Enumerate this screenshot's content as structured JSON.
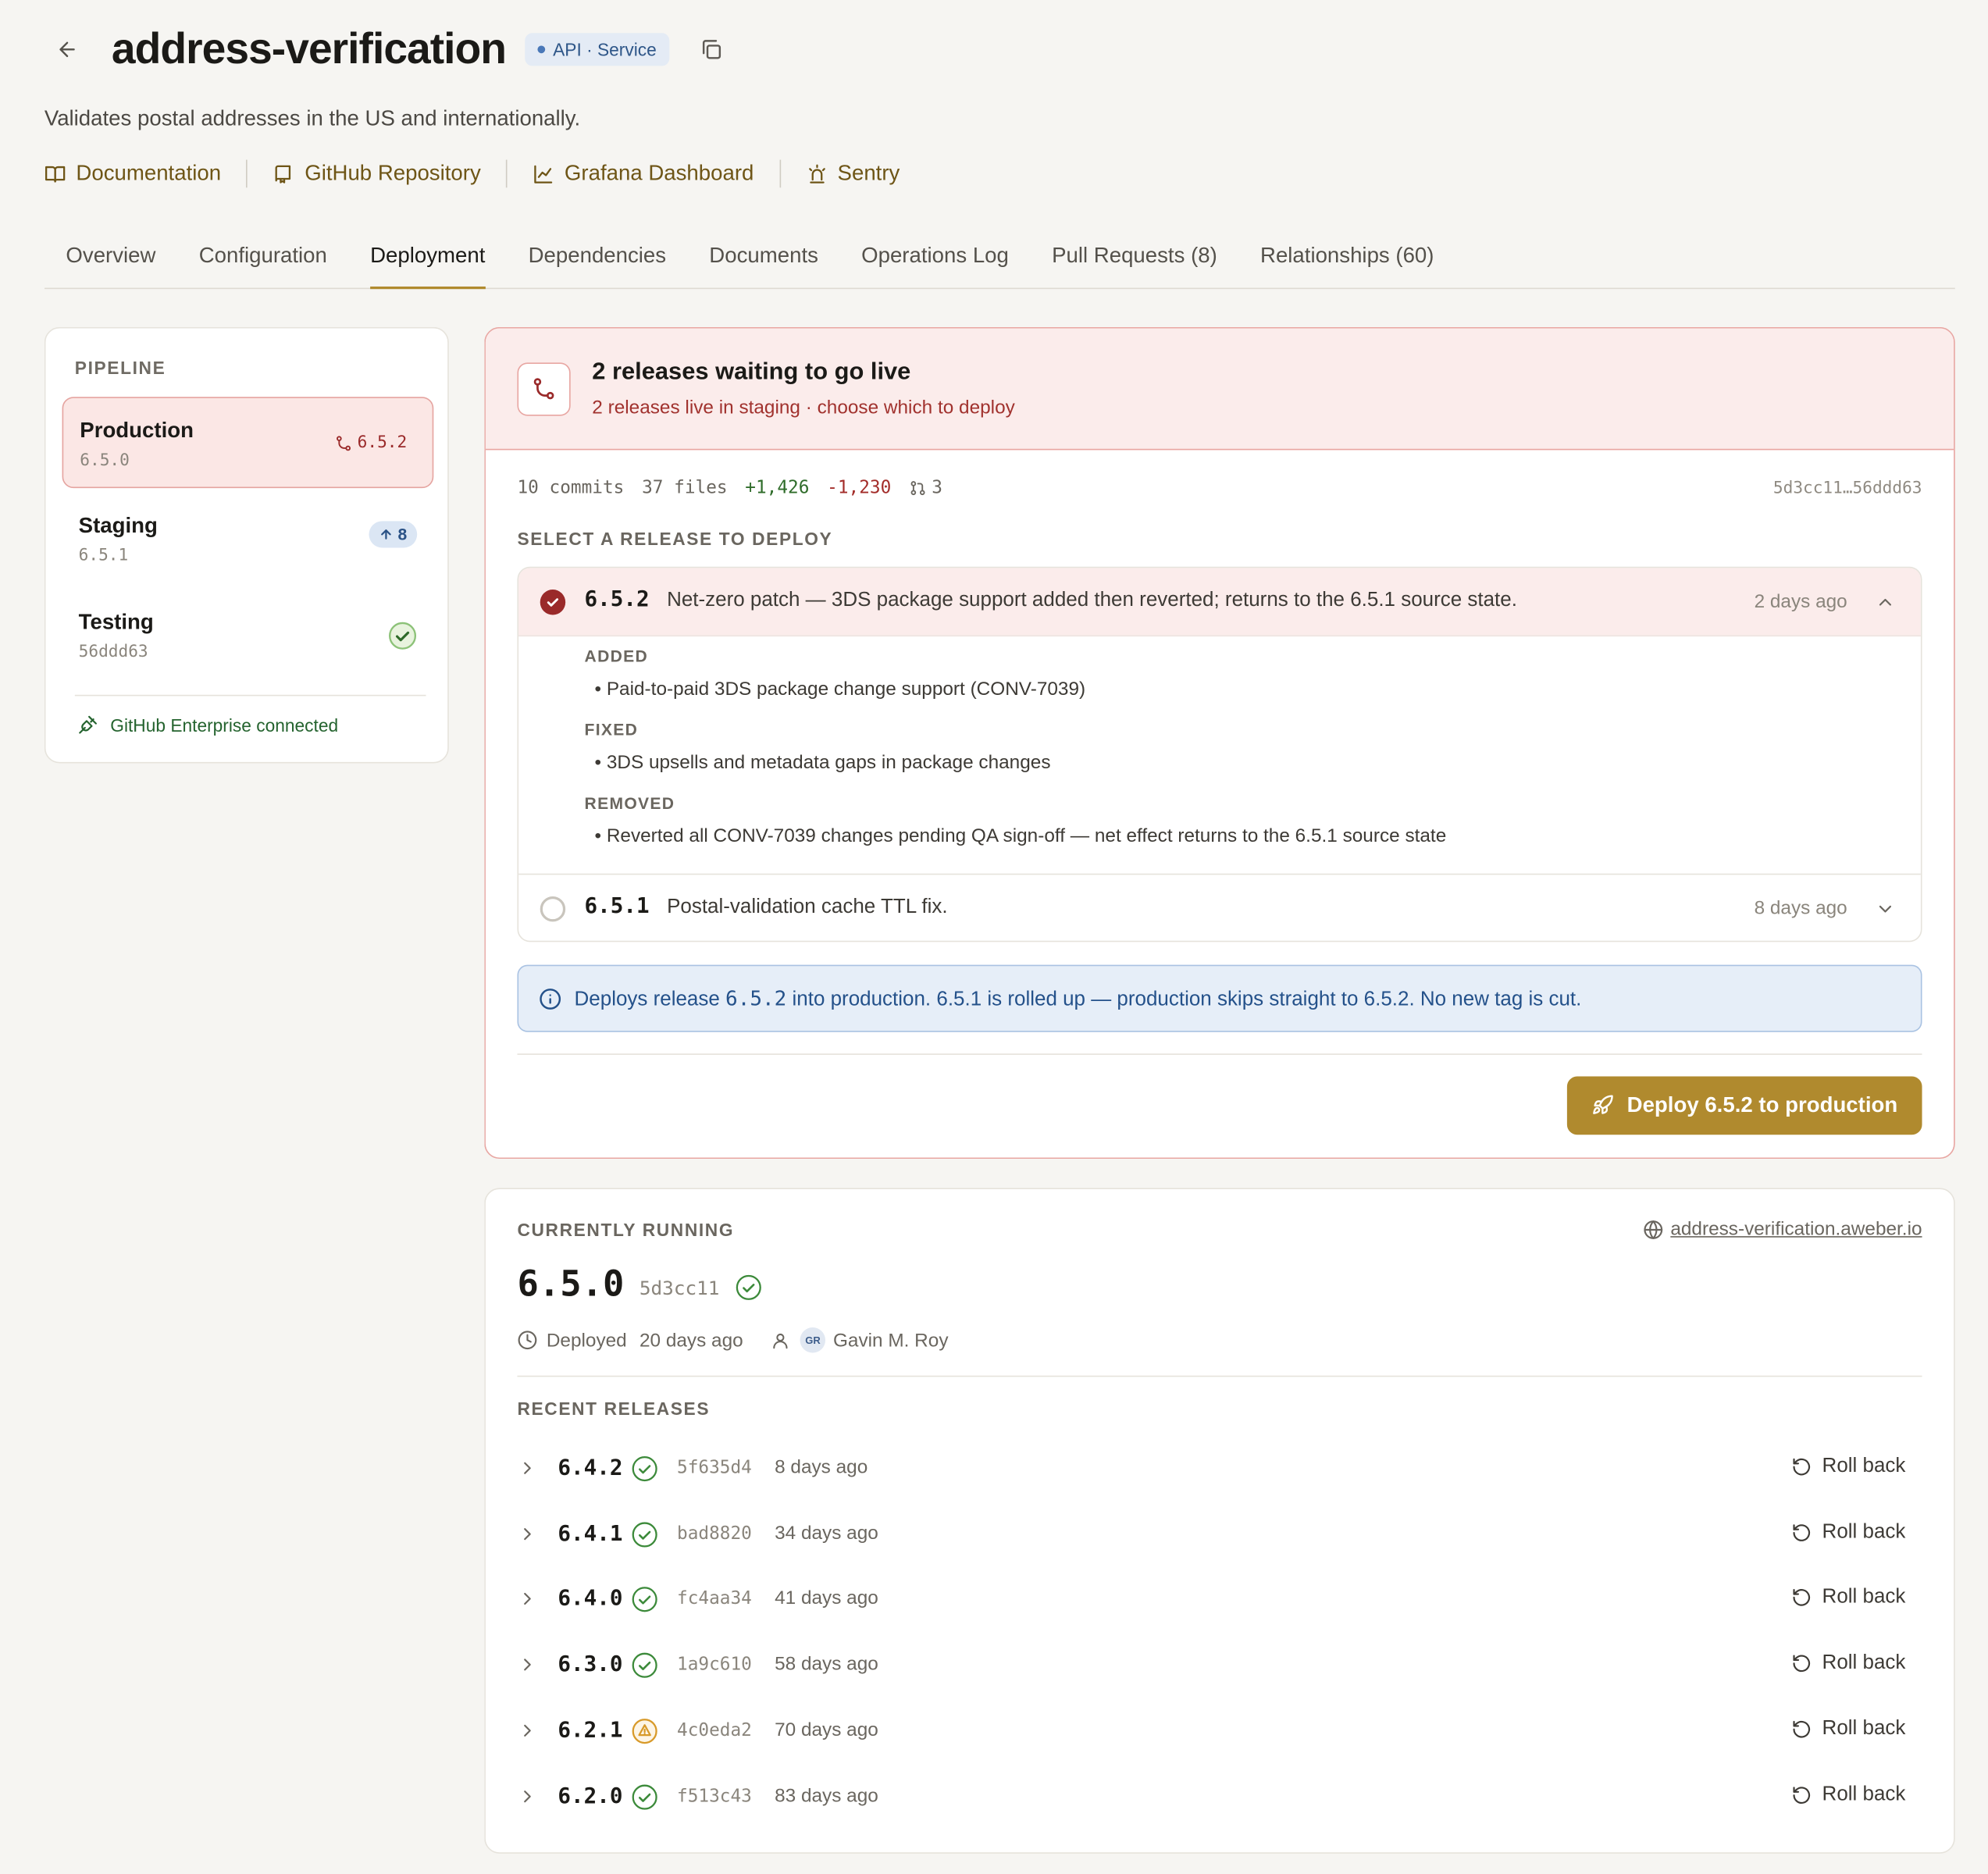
{
  "service": {
    "name": "address-verification",
    "badge": "API · Service",
    "description": "Validates postal addresses in the US and internationally."
  },
  "links": [
    {
      "label": "Documentation",
      "icon": "book-icon"
    },
    {
      "label": "GitHub Repository",
      "icon": "repo-icon"
    },
    {
      "label": "Grafana Dashboard",
      "icon": "chart-icon"
    },
    {
      "label": "Sentry",
      "icon": "siren-icon"
    }
  ],
  "tabs": [
    "Overview",
    "Configuration",
    "Deployment",
    "Dependencies",
    "Documents",
    "Operations Log",
    "Pull Requests (8)",
    "Relationships (60)"
  ],
  "active_tab": "Deployment",
  "pipeline": {
    "heading": "PIPELINE",
    "stages": [
      {
        "name": "Production",
        "version": "6.5.0",
        "pending": "6.5.2"
      },
      {
        "name": "Staging",
        "version": "6.5.1",
        "ahead": "8"
      },
      {
        "name": "Testing",
        "version": "56ddd63",
        "status": "ok"
      }
    ],
    "connection": "GitHub Enterprise connected"
  },
  "waiting": {
    "title": "2 releases waiting to go live",
    "subtitle": "2 releases live in staging · choose which to deploy",
    "stats": {
      "commits": "10 commits",
      "files": "37 files",
      "additions": "+1,426",
      "deletions": "-1,230",
      "prs": "3"
    },
    "range": "5d3cc11…56ddd63",
    "select_heading": "SELECT A RELEASE TO DEPLOY",
    "releases": [
      {
        "version": "6.5.2",
        "description": "Net-zero patch — 3DS package support added then reverted; returns to the 6.5.1 source state.",
        "when": "2 days ago",
        "selected": true,
        "notes": [
          {
            "heading": "ADDED",
            "item": "Paid-to-paid 3DS package change support (CONV-7039)"
          },
          {
            "heading": "FIXED",
            "item": "3DS upsells and metadata gaps in package changes"
          },
          {
            "heading": "REMOVED",
            "item": "Reverted all CONV-7039 changes pending QA sign-off — net effect returns to the 6.5.1 source state"
          }
        ]
      },
      {
        "version": "6.5.1",
        "description": "Postal-validation cache TTL fix.",
        "when": "8 days ago",
        "selected": false
      }
    ],
    "info": {
      "prefix": "Deploys release",
      "version": "6.5.2",
      "suffix": "into production. 6.5.1 is rolled up — production skips straight to 6.5.2. No new tag is cut."
    },
    "deploy_label": "Deploy 6.5.2 to production"
  },
  "running": {
    "heading": "CURRENTLY RUNNING",
    "url": "address-verification.aweber.io",
    "version": "6.5.0",
    "commit": "5d3cc11",
    "deployed_label": "Deployed",
    "deployed_when": "20 days ago",
    "user_initials": "GR",
    "user": "Gavin M. Roy",
    "recent_heading": "RECENT RELEASES",
    "recent": [
      {
        "version": "6.4.2",
        "status": "ok",
        "hash": "5f635d4",
        "when": "8 days ago",
        "action": "Roll back"
      },
      {
        "version": "6.4.1",
        "status": "ok",
        "hash": "bad8820",
        "when": "34 days ago",
        "action": "Roll back"
      },
      {
        "version": "6.4.0",
        "status": "ok",
        "hash": "fc4aa34",
        "when": "41 days ago",
        "action": "Roll back"
      },
      {
        "version": "6.3.0",
        "status": "ok",
        "hash": "1a9c610",
        "when": "58 days ago",
        "action": "Roll back"
      },
      {
        "version": "6.2.1",
        "status": "warning",
        "hash": "4c0eda2",
        "when": "70 days ago",
        "action": "Roll back"
      },
      {
        "version": "6.2.0",
        "status": "ok",
        "hash": "f513c43",
        "when": "83 days ago",
        "action": "Roll back"
      }
    ]
  },
  "colors": {
    "accent": "#b08a2e",
    "danger": "#9a2a2a",
    "ok": "#3c8a3a",
    "warning": "#d89a2a",
    "info": "#24518a"
  }
}
